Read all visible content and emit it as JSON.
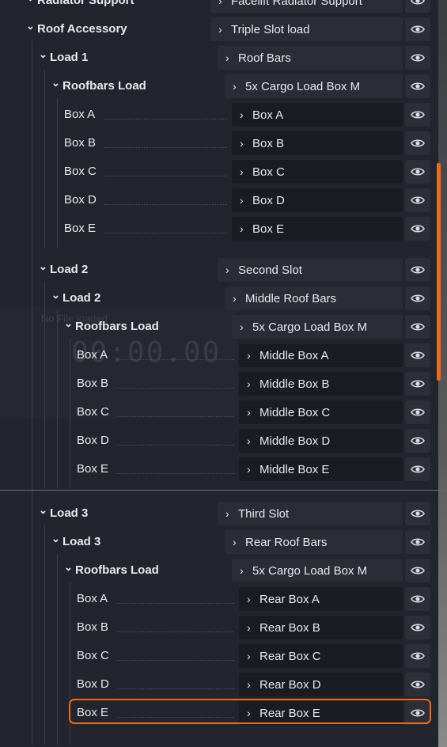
{
  "rows": [
    {
      "label": "Radiator Support",
      "field": "Facelift Radiator Support"
    },
    {
      "label": "Roof Accessory",
      "field": "Triple Slot load"
    },
    {
      "label": "Load 1",
      "field": "Roof Bars"
    },
    {
      "label": "Roofbars Load",
      "field": "5x Cargo Load Box M"
    },
    {
      "label": "Box A",
      "field": "Box A"
    },
    {
      "label": "Box B",
      "field": "Box B"
    },
    {
      "label": "Box C",
      "field": "Box C"
    },
    {
      "label": "Box D",
      "field": "Box D"
    },
    {
      "label": "Box E",
      "field": "Box E"
    },
    {
      "label": "Load 2",
      "field": "Second Slot"
    },
    {
      "label": "Load 2",
      "field": "Middle Roof Bars"
    },
    {
      "label": "Roofbars Load",
      "field": "5x Cargo Load Box M"
    },
    {
      "label": "Box A",
      "field": "Middle Box A"
    },
    {
      "label": "Box B",
      "field": "Middle Box B"
    },
    {
      "label": "Box C",
      "field": "Middle Box C"
    },
    {
      "label": "Box D",
      "field": "Middle Box D"
    },
    {
      "label": "Box E",
      "field": "Middle Box E"
    },
    {
      "label": "Load 3",
      "field": "Third Slot"
    },
    {
      "label": "Load 3",
      "field": "Rear Roof Bars"
    },
    {
      "label": "Roofbars Load",
      "field": "5x Cargo Load Box M"
    },
    {
      "label": "Box A",
      "field": "Rear Box A"
    },
    {
      "label": "Box B",
      "field": "Rear Box B"
    },
    {
      "label": "Box C",
      "field": "Rear Box C"
    },
    {
      "label": "Box D",
      "field": "Rear Box D"
    },
    {
      "label": "Box E",
      "field": "Rear Box E"
    }
  ],
  "overlay": {
    "file_status": "No File loaded",
    "timer": "00:00.00"
  },
  "colors": {
    "accent": "#f06a17"
  }
}
